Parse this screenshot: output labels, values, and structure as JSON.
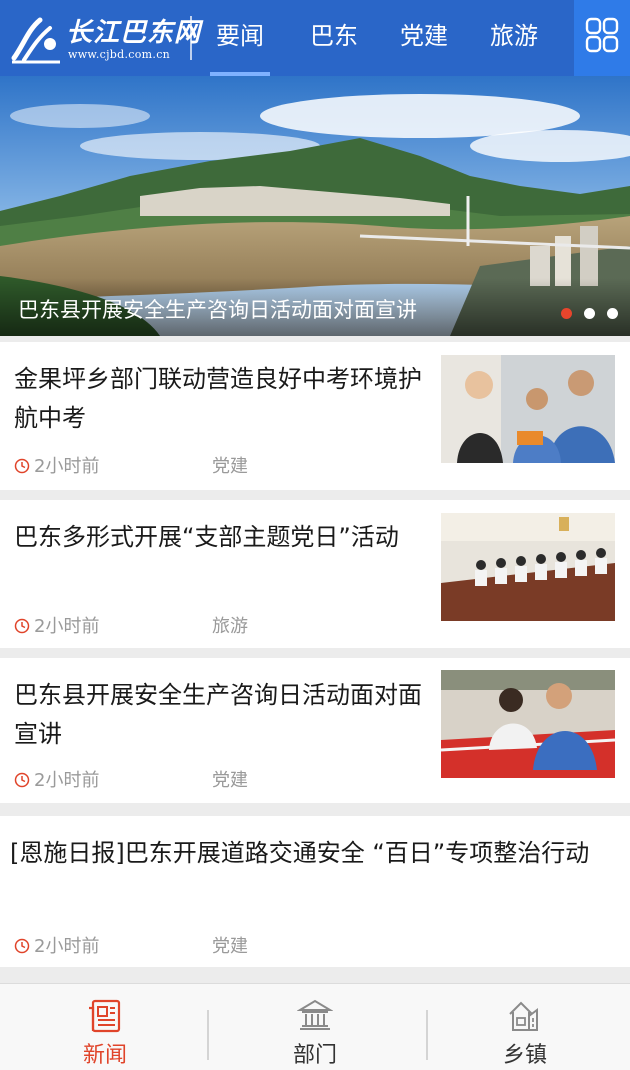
{
  "header": {
    "logo_title": "长江巴东网",
    "logo_url": "www.cjbd.com.cn",
    "tabs": [
      {
        "label": "要闻",
        "active": true
      },
      {
        "label": "巴东",
        "active": false
      },
      {
        "label": "党建",
        "active": false
      },
      {
        "label": "旅游",
        "active": false
      }
    ],
    "menu_icon": "grid-icon"
  },
  "banner": {
    "caption": "巴东县开展安全生产咨询日活动面对面宣讲",
    "slide_count": 3,
    "active_slide": 1
  },
  "news": [
    {
      "title": "金果坪乡部门联动营造良好中考环境护航中考",
      "time": "2小时前",
      "category": "党建",
      "has_thumb": true
    },
    {
      "title": "巴东多形式开展“支部主题党日”活动",
      "time": "2小时前",
      "category": "旅游",
      "has_thumb": true
    },
    {
      "title": "巴东县开展安全生产咨询日活动面对面宣讲",
      "time": "2小时前",
      "category": "党建",
      "has_thumb": true
    },
    {
      "title": "[恩施日报]巴东开展道路交通安全 “百日”专项整治行动",
      "time": "2小时前",
      "category": "党建",
      "has_thumb": false
    }
  ],
  "tabbar": {
    "items": [
      {
        "label": "新闻",
        "icon": "newspaper-icon",
        "active": true
      },
      {
        "label": "部门",
        "icon": "government-building-icon",
        "active": false
      },
      {
        "label": "乡镇",
        "icon": "town-house-icon",
        "active": false
      }
    ]
  },
  "colors": {
    "header_blue": "#2a66c8",
    "accent_red": "#e0442a",
    "meta_gray": "#9a9a9a"
  }
}
